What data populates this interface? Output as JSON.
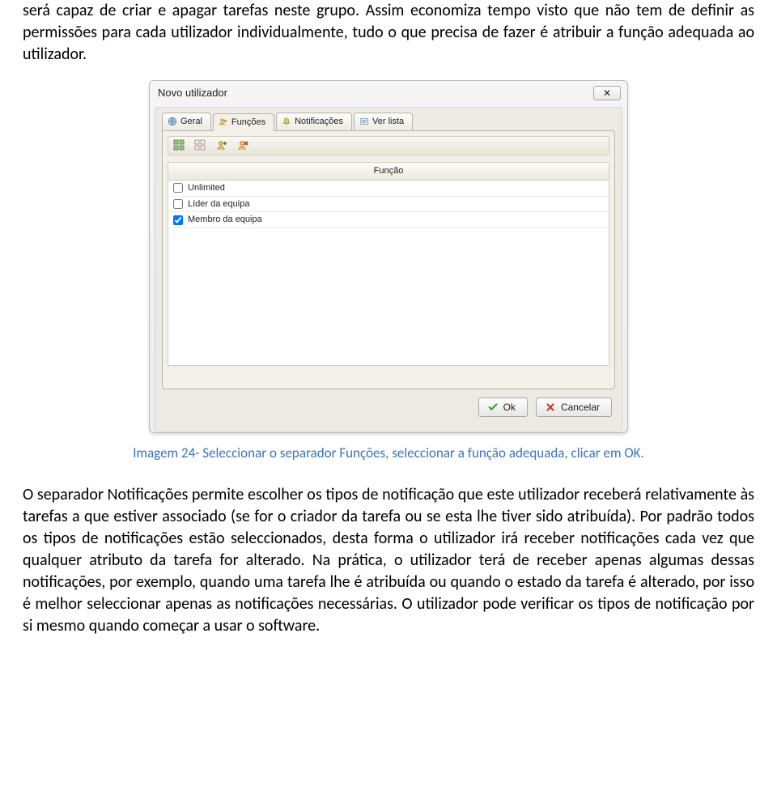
{
  "paragraph_top": "será capaz de criar e apagar tarefas neste grupo. Assim economiza tempo visto que não tem de definir as permissões para cada utilizador individualmente, tudo o que precisa de fazer é atribuir a função adequada ao utilizador.",
  "dialog": {
    "title": "Novo utilizador",
    "tabs": {
      "geral": "Geral",
      "funcoes": "Funções",
      "notificacoes": "Notificações",
      "verlista": "Ver lista"
    },
    "table_header": "Função",
    "rows": [
      {
        "label": "Unlimited",
        "checked": false
      },
      {
        "label": "Líder da equipa",
        "checked": false
      },
      {
        "label": "Membro da equipa",
        "checked": true
      }
    ],
    "buttons": {
      "ok": "Ok",
      "cancel": "Cancelar"
    }
  },
  "caption": "Imagem 24- Seleccionar o separador Funções, seleccionar a função adequada, clicar em OK.",
  "paragraph_bottom": "O separador Notificações permite escolher os tipos de notificação que este utilizador receberá relativamente às tarefas a que estiver associado (se for o criador da tarefa ou se esta lhe tiver sido atribuída). Por padrão todos os tipos de notificações estão seleccionados, desta forma o utilizador irá receber notificações cada vez que qualquer atributo da tarefa for alterado. Na prática, o utilizador terá de receber apenas algumas dessas notificações, por exemplo, quando uma tarefa lhe é atribuída ou quando o estado da tarefa é alterado, por isso é melhor seleccionar apenas as notificações necessárias. O utilizador pode verificar os tipos de notificação por si mesmo quando começar a usar o software."
}
